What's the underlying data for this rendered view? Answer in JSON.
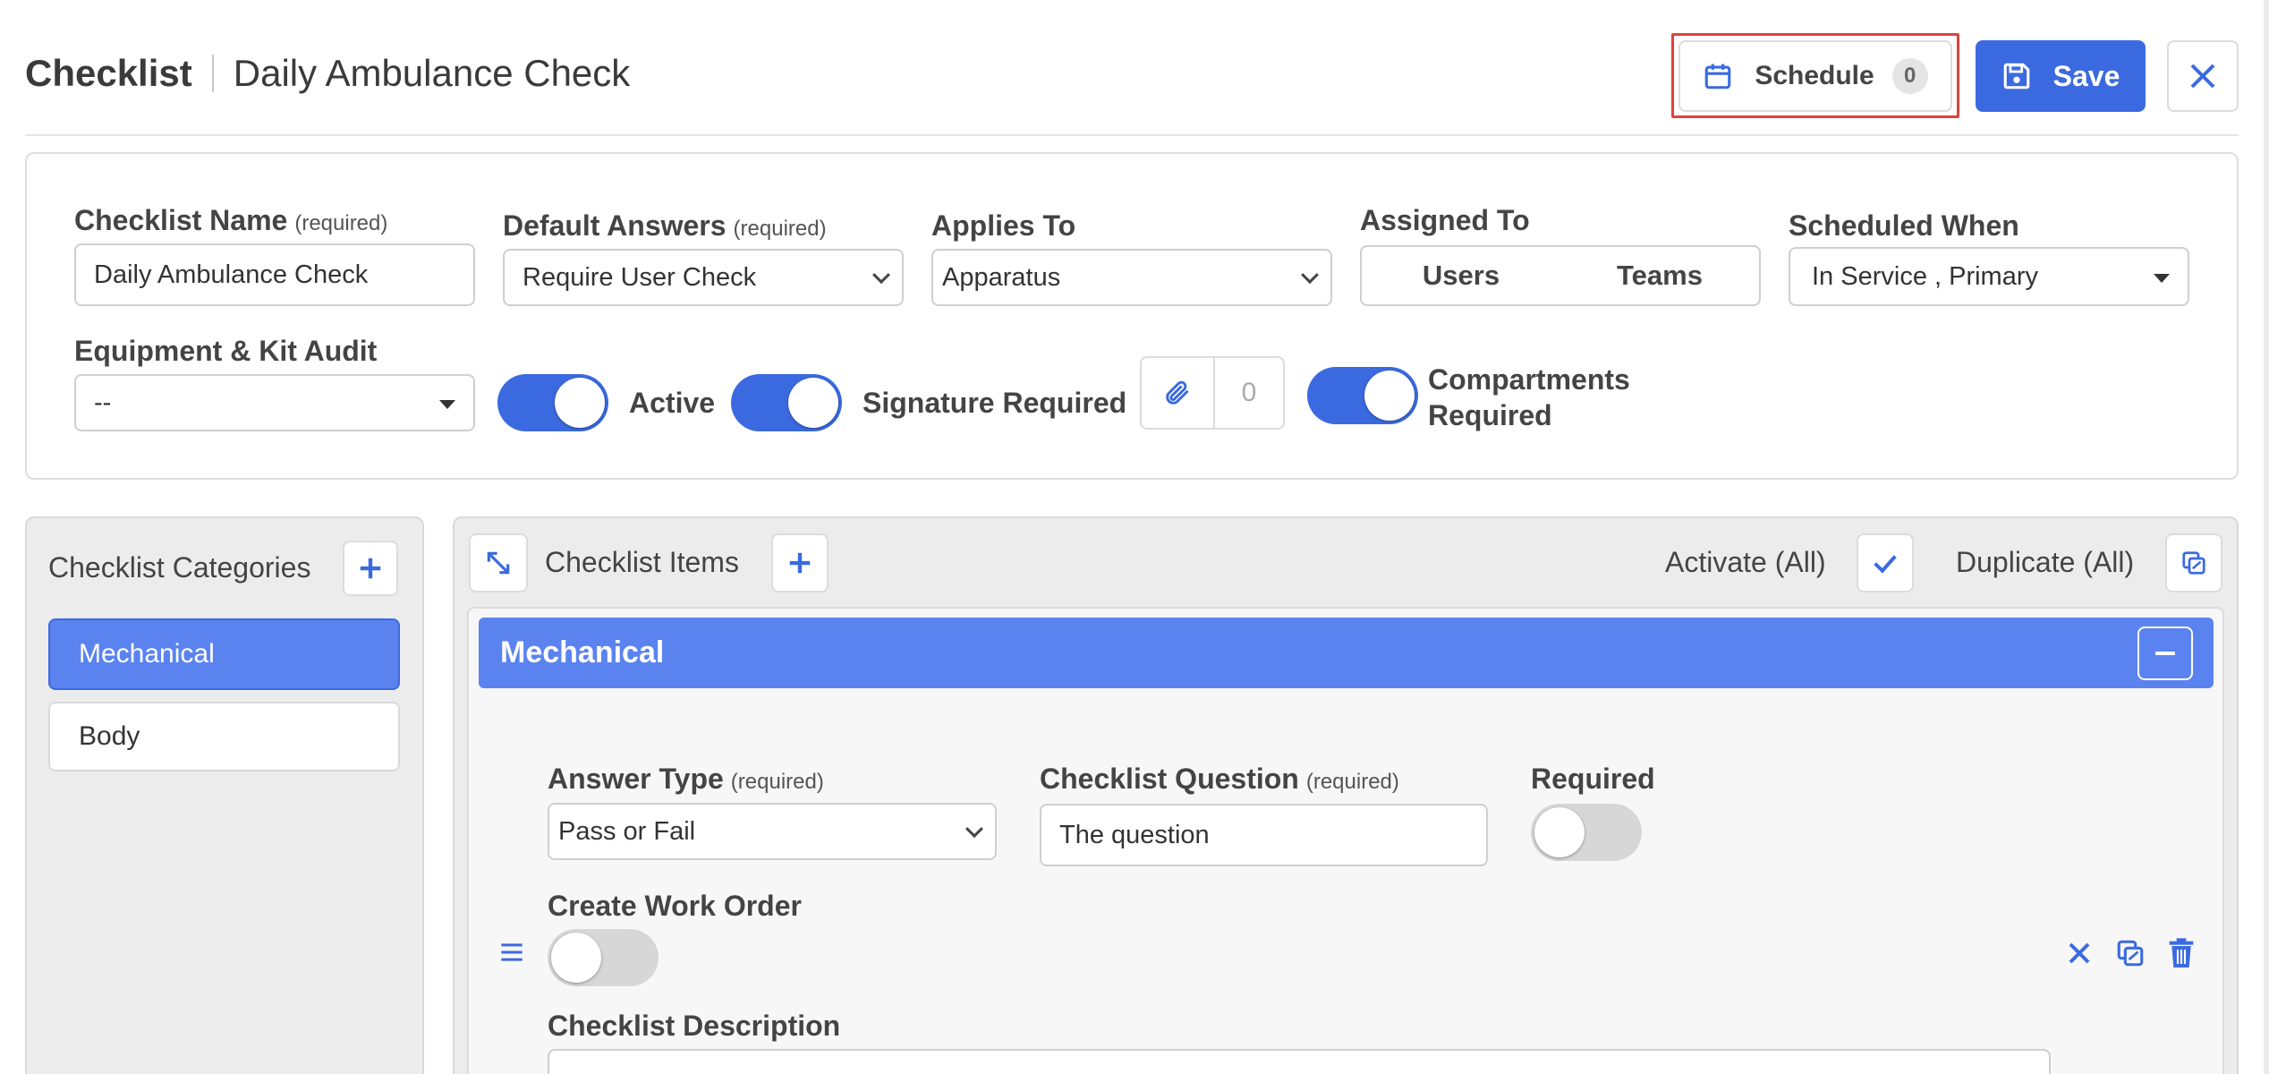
{
  "header": {
    "title": "Checklist",
    "subtitle": "Daily Ambulance Check",
    "schedule_label": "Schedule",
    "schedule_count": "0",
    "save_label": "Save"
  },
  "form": {
    "checklist_name_label": "Checklist Name",
    "checklist_name_req": "(required)",
    "checklist_name_value": "Daily Ambulance Check",
    "default_answers_label": "Default Answers",
    "default_answers_req": "(required)",
    "default_answers_value": "Require User Check",
    "applies_to_label": "Applies To",
    "applies_to_value": "Apparatus",
    "assigned_to_label": "Assigned To",
    "assigned_users": "Users",
    "assigned_teams": "Teams",
    "scheduled_when_label": "Scheduled When",
    "scheduled_when_value": "In Service , Primary",
    "equipment_label": "Equipment & Kit Audit",
    "equipment_value": "--",
    "active_label": "Active",
    "active_on": true,
    "signature_label": "Signature Required",
    "signature_on": true,
    "attachment_count": "0",
    "compartments_label_1": "Compartments",
    "compartments_label_2": "Required",
    "compartments_on": true
  },
  "categories": {
    "title": "Checklist Categories",
    "items": [
      {
        "label": "Mechanical",
        "selected": true
      },
      {
        "label": "Body",
        "selected": false
      }
    ]
  },
  "items_panel": {
    "title": "Checklist Items",
    "activate_all": "Activate (All)",
    "duplicate_all": "Duplicate (All)",
    "section_title": "Mechanical",
    "answer_type_label": "Answer Type",
    "answer_type_req": "(required)",
    "answer_type_value": "Pass or Fail",
    "question_label": "Checklist Question",
    "question_req": "(required)",
    "question_value": "The question",
    "required_label": "Required",
    "required_on": false,
    "work_order_label": "Create Work Order",
    "work_order_on": false,
    "description_label": "Checklist Description"
  },
  "colors": {
    "primary": "#3b6ae0",
    "section_header": "#5b83f0",
    "highlight_border": "#e0423c"
  },
  "icons": [
    "calendar-icon",
    "save-icon",
    "close-icon",
    "paperclip-icon",
    "expand-icon",
    "plus-icon",
    "check-icon",
    "copy-icon",
    "minus-icon",
    "drag-handle-icon",
    "delete-icon"
  ]
}
